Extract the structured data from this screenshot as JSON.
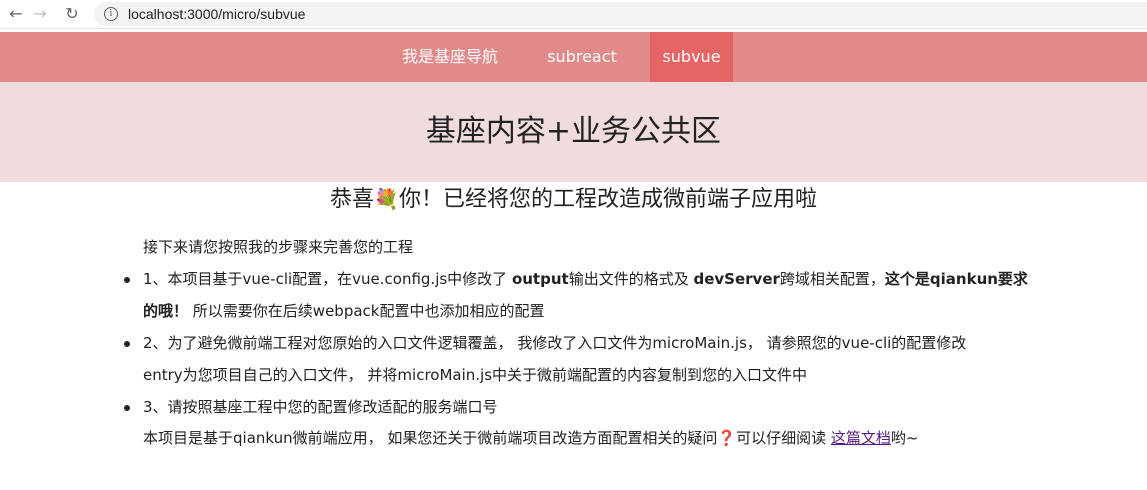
{
  "browser": {
    "url": "localhost:3000/micro/subvue"
  },
  "nav": {
    "items": [
      {
        "label": "我是基座导航",
        "active": false
      },
      {
        "label": "subreact",
        "active": false
      },
      {
        "label": "subvue",
        "active": true
      }
    ]
  },
  "header": {
    "title": "基座内容+业务公共区"
  },
  "main": {
    "title_before": "恭喜",
    "title_emoji": "💐",
    "title_after": "你！已经将您的工程改造成微前端子应用啦",
    "intro": "接下来请您按照我的步骤来完善您的工程",
    "item1": {
      "t1": "1、本项目基于vue-cli配置，在vue.config.js中修改了 ",
      "b1": "output",
      "t2": "输出文件的格式及 ",
      "b2": "devServer",
      "t3": "跨域相关配置，",
      "b3": "这个是qiankun要求",
      "b4": "的哦！",
      "t4": "所以需要你在后续webpack配置中也添加相应的配置"
    },
    "item2": {
      "line1": "2、为了避免微前端工程对您原始的入口文件逻辑覆盖， 我修改了入口文件为microMain.js， 请参照您的vue-cli的配置修改",
      "line2": "entry为您项目自己的入口文件， 并将microMain.js中关于微前端配置的内容复制到您的入口文件中"
    },
    "item3": "3、请按照基座工程中您的配置修改适配的服务端口号",
    "footer": {
      "before": "本项目是基于qiankun微前端应用， 如果您还关于微前端项目改造方面配置相关的疑问",
      "q": "❓",
      "mid": "可以仔细阅读 ",
      "link": "这篇文档",
      "after": "哟~"
    }
  },
  "colors": {
    "nav_bg": "#e28a89",
    "nav_active": "#e46564",
    "header_bg": "#f0dcdd"
  }
}
